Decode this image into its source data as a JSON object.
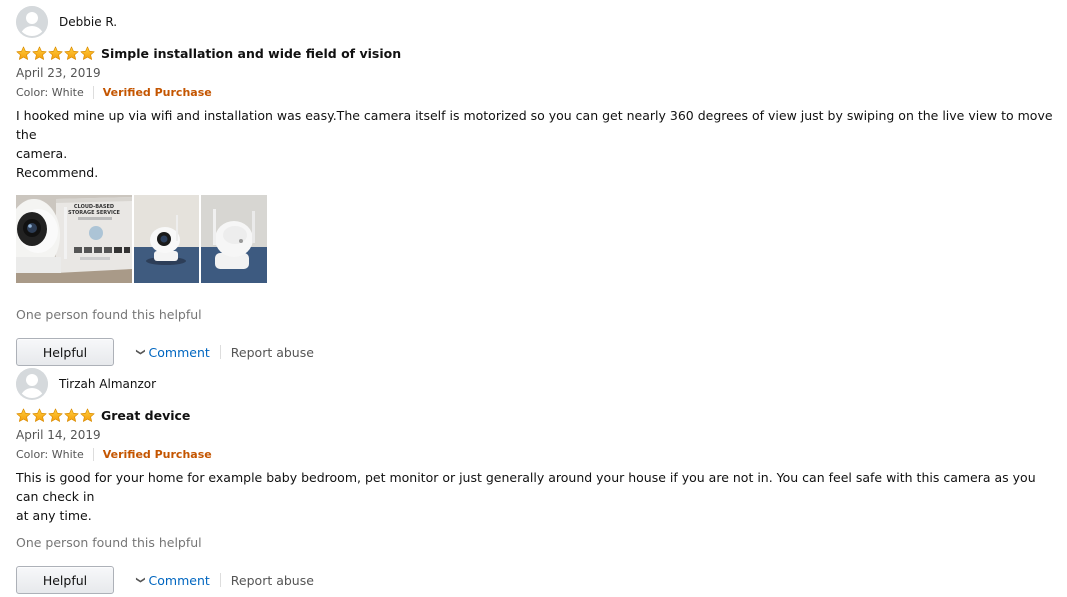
{
  "reviews": [
    {
      "reviewer": "Debbie R.",
      "rating": 5,
      "title": "Simple installation and wide field of vision",
      "date": "April 23, 2019",
      "color": "Color: White",
      "verified": "Verified Purchase",
      "body_lines": [
        "I hooked mine up via wifi and installation was easy.The camera itself is motorized so you can get nearly 360 degrees of view just by swiping on the live view to move the",
        "camera.",
        "Recommend."
      ],
      "image_box_text": [
        "CLOUD-BASED",
        "STORAGE SERVICE"
      ],
      "helpful_text": "One person found this helpful",
      "helpful_button": "Helpful",
      "comment": "Comment",
      "report": "Report abuse"
    },
    {
      "reviewer": "Tirzah Almanzor",
      "rating": 5,
      "title": "Great device",
      "date": "April 14, 2019",
      "color": "Color: White",
      "verified": "Verified Purchase",
      "body_lines": [
        "This is good for your home for example baby bedroom, pet monitor or just generally around your house if you are not in. You can feel safe with this camera as you can check in",
        "at any time."
      ],
      "helpful_text": "One person found this helpful",
      "helpful_button": "Helpful",
      "comment": "Comment",
      "report": "Report abuse"
    }
  ],
  "colors": {
    "star": "#ffa41c",
    "verified": "#c45500",
    "link": "#0066c0"
  }
}
